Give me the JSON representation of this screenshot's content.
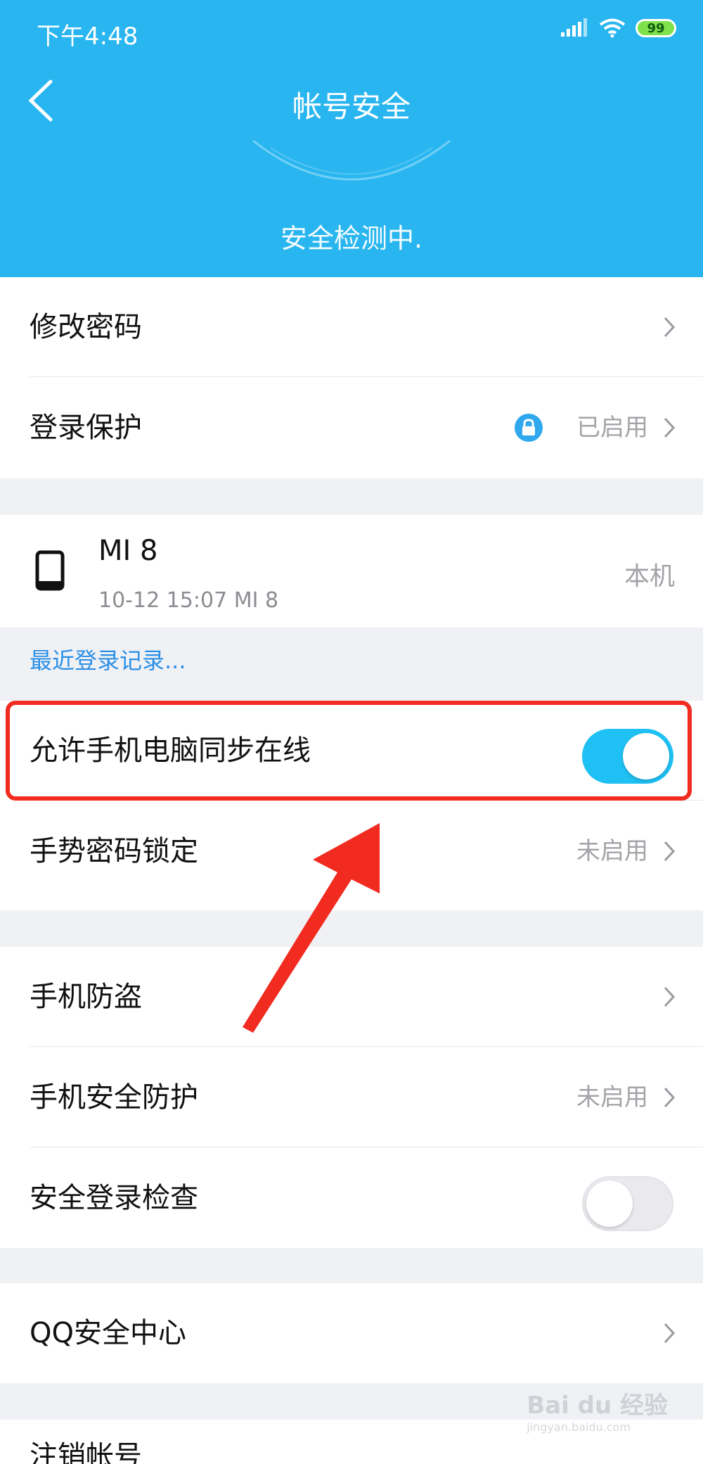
{
  "status_bar": {
    "time": "下午4:48",
    "battery": "99"
  },
  "header": {
    "title": "帐号安全",
    "scan_status": "安全检测中."
  },
  "group1": {
    "change_password": "修改密码",
    "login_protection": "登录保护",
    "login_protection_status": "已启用"
  },
  "device": {
    "name": "MI 8",
    "meta": "10-12 15:07 MI 8",
    "tag": "本机"
  },
  "recent_login_link": "最近登录记录...",
  "group2": {
    "sync_online": "允许手机电脑同步在线",
    "sync_online_on": true,
    "gesture_lock": "手势密码锁定",
    "gesture_lock_status": "未启用"
  },
  "group3": {
    "anti_theft": "手机防盗",
    "phone_protection": "手机安全防护",
    "phone_protection_status": "未启用",
    "secure_login_check": "安全登录检查",
    "secure_login_check_on": false
  },
  "group4": {
    "qq_security_center": "QQ安全中心"
  },
  "group5": {
    "deactivate_account": "注销帐号"
  },
  "watermark": {
    "text": "Bai du 经验",
    "sub": "jingyan.baidu.com"
  },
  "colors": {
    "header": "#29b6f0",
    "toggle_on": "#1fc0f3",
    "highlight": "#f12b1f",
    "link": "#2b8fe6"
  },
  "icons": [
    "signal-icon",
    "wifi-icon",
    "battery-icon",
    "back-icon",
    "lock-icon",
    "phone-icon",
    "chevron-right-icon",
    "arrow-annotation-icon"
  ]
}
